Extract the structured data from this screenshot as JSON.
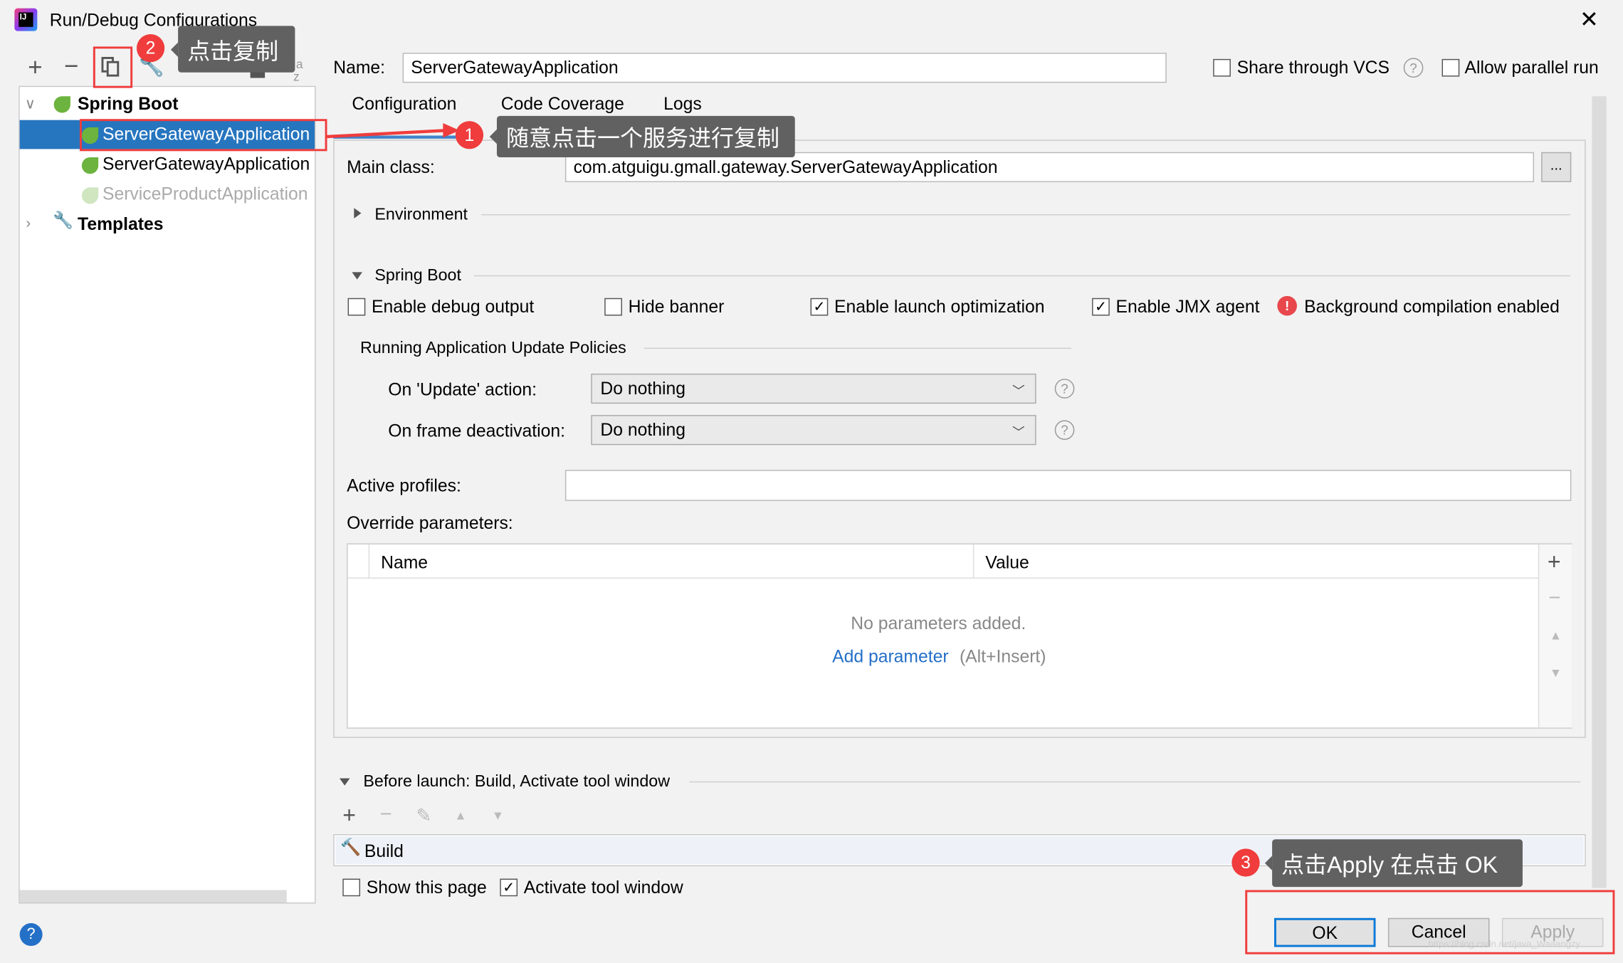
{
  "window": {
    "title": "Run/Debug Configurations",
    "close_icon": "close-icon",
    "app_icon": "intellij-icon"
  },
  "toolbar": {
    "icons": [
      "plus-icon",
      "minus-icon",
      "copy-icon",
      "wrench-icon",
      "arrow-up-icon",
      "arrow-down-icon",
      "folder-icon",
      "sort-alpha-icon"
    ]
  },
  "tree": {
    "groups": [
      {
        "label": "Spring Boot",
        "expanded": true,
        "items": [
          {
            "label": "ServerGatewayApplication",
            "selected": true
          },
          {
            "label": "ServerGatewayApplication",
            "selected": false
          },
          {
            "label": "ServiceProductApplication",
            "selected": false,
            "dimmed": true
          }
        ]
      },
      {
        "label": "Templates",
        "expanded": false
      }
    ]
  },
  "header": {
    "name_label": "Name:",
    "name_value": "ServerGatewayApplication",
    "share_vcs": {
      "label": "Share through VCS",
      "checked": false
    },
    "allow_parallel": {
      "label": "Allow parallel run",
      "checked": false
    }
  },
  "tabs": [
    {
      "label": "Configuration",
      "active": true
    },
    {
      "label": "Code Coverage"
    },
    {
      "label": "Logs"
    }
  ],
  "config": {
    "main_class_label": "Main class:",
    "main_class_value": "com.atguigu.gmall.gateway.ServerGatewayApplication",
    "browse_label": "...",
    "environment_label": "Environment",
    "spring_boot_label": "Spring Boot",
    "checks": [
      {
        "label": "Enable debug output",
        "checked": false
      },
      {
        "label": "Hide banner",
        "checked": false
      },
      {
        "label": "Enable launch optimization",
        "checked": true
      },
      {
        "label": "Enable JMX agent",
        "checked": true
      }
    ],
    "bg_compilation": "Background compilation enabled",
    "policies_label": "Running Application Update Policies",
    "update_action_label": "On 'Update' action:",
    "update_action_value": "Do nothing",
    "frame_deactivation_label": "On frame deactivation:",
    "frame_deactivation_value": "Do nothing",
    "active_profiles_label": "Active profiles:",
    "active_profiles_value": "",
    "override_label": "Override parameters:",
    "table": {
      "columns": [
        "Name",
        "Value"
      ],
      "empty_text": "No parameters added.",
      "add_link": "Add parameter",
      "add_shortcut": "(Alt+Insert)"
    }
  },
  "before_launch": {
    "label": "Before launch: Build, Activate tool window",
    "tasks": [
      "Build"
    ],
    "show_page": {
      "label": "Show this page",
      "checked": false
    },
    "activate_tool": {
      "label": "Activate tool window",
      "checked": true
    }
  },
  "buttons": {
    "ok": "OK",
    "cancel": "Cancel",
    "apply": "Apply"
  },
  "annotations": [
    {
      "number": "1",
      "text": "随意点击一个服务进行复制"
    },
    {
      "number": "2",
      "text": "点击复制"
    },
    {
      "number": "3",
      "text": "点击Apply 在点击 OK"
    }
  ],
  "watermark": "https://blog.csdn.net/java_Waaangzy",
  "colors": {
    "selection": "#2675bf",
    "annotation_red": "#f03c3c",
    "tooltip": "#616161",
    "link": "#2470c7"
  }
}
